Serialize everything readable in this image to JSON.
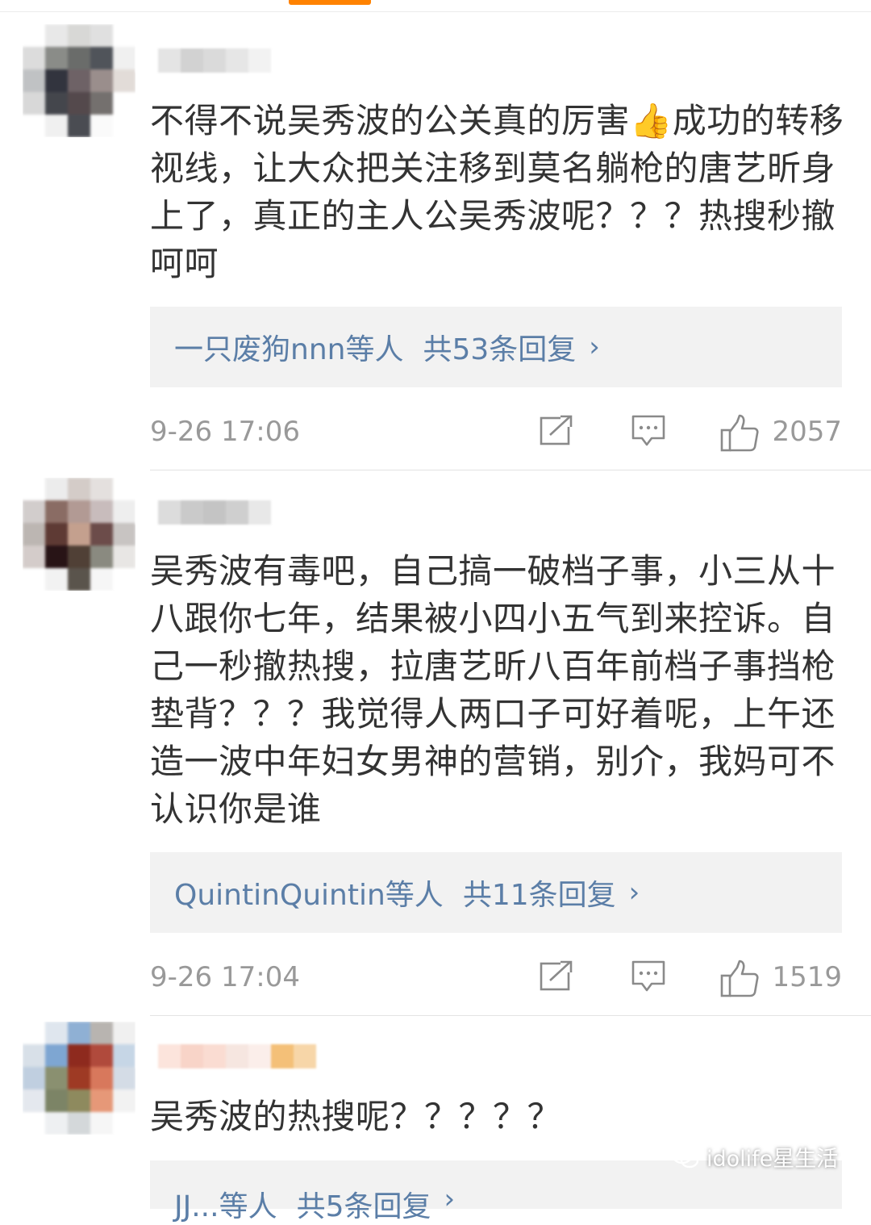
{
  "comments": [
    {
      "text": "不得不说吴秀波的公关真的厉害👍成功的转移视线，让大众把关注移到莫名躺枪的唐艺昕身上了，真正的主人公吴秀波呢？？？热搜秒撤呵呵",
      "replies_by": "一只废狗nnn等人",
      "replies_count": "共53条回复",
      "time": "9-26 17:06",
      "likes": "2057"
    },
    {
      "text": "吴秀波有毒吧，自己搞一破档子事，小三从十八跟你七年，结果被小四小五气到来控诉。自己一秒撤热搜，拉唐艺昕八百年前档子事挡枪垫背？？？我觉得人两口子可好着呢，上午还造一波中年妇女男神的营销，别介，我妈可不认识你是谁",
      "replies_by": "QuintinQuintin等人",
      "replies_count": "共11条回复",
      "time": "9-26 17:04",
      "likes": "1519"
    },
    {
      "text": "吴秀波的热搜呢？？？？？",
      "replies_by": "JJ...等人",
      "replies_count": "共5条回复"
    }
  ],
  "reply_chevron": "›",
  "watermark": "idolife星生活",
  "icons": [
    "repost-icon",
    "comment-icon",
    "like-icon",
    "wechat-icon"
  ],
  "colors": {
    "link": "#5b7ea7",
    "text": "#333333",
    "meta": "#999999",
    "reply_bg": "#f2f2f2",
    "accent": "#ff8200"
  }
}
